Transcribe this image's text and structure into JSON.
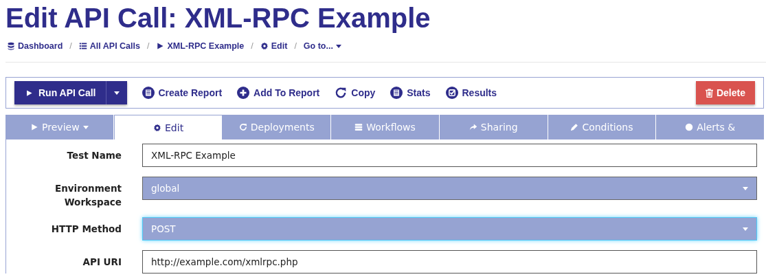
{
  "page": {
    "title": "Edit API Call: XML-RPC Example"
  },
  "breadcrumb": [
    {
      "kind": "link",
      "label": "Dashboard"
    },
    {
      "kind": "separator",
      "label": "/"
    },
    {
      "kind": "link",
      "label": "All API Calls"
    },
    {
      "kind": "separator",
      "label": "/"
    },
    {
      "kind": "link",
      "label": "XML-RPC Example"
    },
    {
      "kind": "separator",
      "label": "/"
    },
    {
      "kind": "link",
      "label": "Edit"
    },
    {
      "kind": "separator",
      "label": "/"
    },
    {
      "kind": "menu",
      "label": "Go to..."
    }
  ],
  "toolbar": {
    "primary": {
      "label": "Run API Call"
    },
    "actions": [
      {
        "label": "Create Report"
      },
      {
        "label": "Add To Report"
      },
      {
        "label": "Copy"
      },
      {
        "label": "Stats"
      },
      {
        "label": "Results"
      }
    ],
    "danger": {
      "label": "Delete"
    }
  },
  "tabs": [
    {
      "label": "Preview",
      "dropdown": true,
      "selected": false
    },
    {
      "label": "Edit",
      "dropdown": false,
      "selected": true
    },
    {
      "label": "Deployments",
      "dropdown": false,
      "selected": false
    },
    {
      "label": "Workflows",
      "dropdown": false,
      "selected": false
    },
    {
      "label": "Sharing",
      "dropdown": false,
      "selected": false
    },
    {
      "label": "Conditions",
      "dropdown": false,
      "selected": false
    },
    {
      "label": "Alerts &",
      "dropdown": false,
      "selected": false
    }
  ],
  "form": [
    {
      "label": "Test Name",
      "kind": "text",
      "value": "XML-RPC Example",
      "focused": false
    },
    {
      "label": "Environment Workspace",
      "kind": "select",
      "value": "global",
      "focused": false
    },
    {
      "label": "HTTP Method",
      "kind": "select",
      "value": "POST",
      "focused": true
    },
    {
      "label": "API URI",
      "kind": "text",
      "value": "http://example.com/xmlrpc.php",
      "focused": false
    }
  ]
}
